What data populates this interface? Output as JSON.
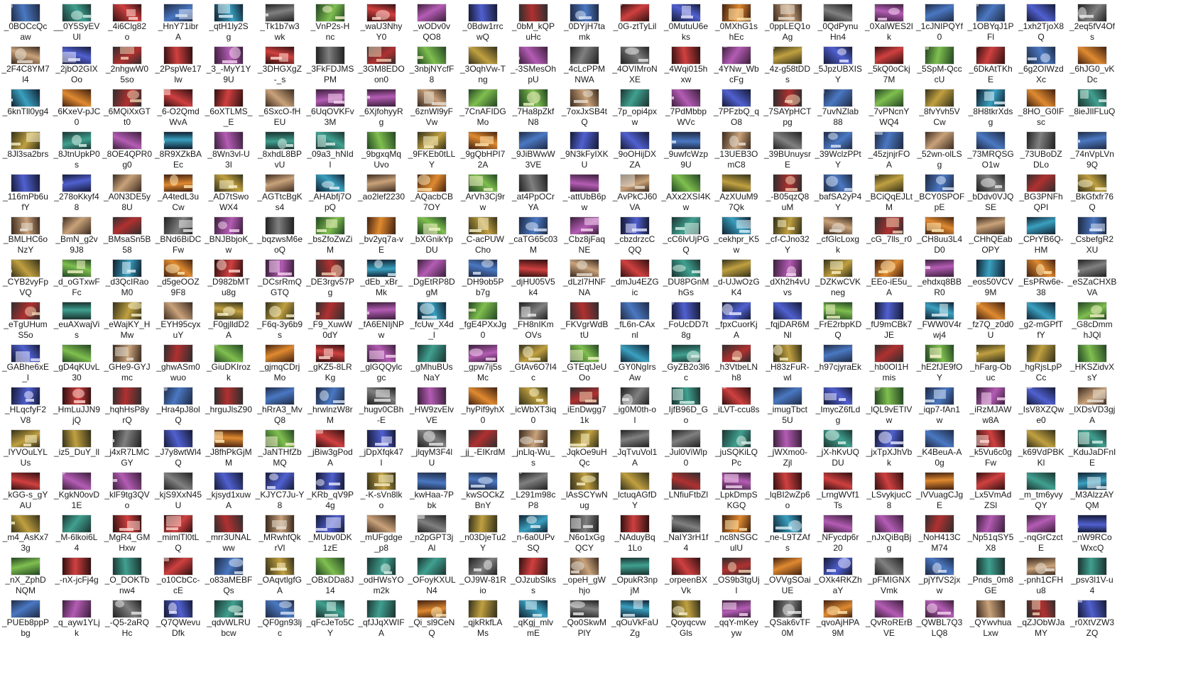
{
  "files": [
    [
      "_0BOCcQc|aw",
      "__0Y5SyEV|Ul",
      "_4i6Clg82|o",
      "_HnY71ibr|A",
      "_qtH1ly2S|g",
      "_Tk1b7w3|wk",
      "_VnP2s-H|nc",
      "_waU3Nhy|Y0",
      "_wODv0v|QO8",
      "_0Bdw1rrc|wQ",
      "_0bM_kQP|uHc",
      "_0DYjH7ta|mk",
      "_0G-ztTyLil|",
      "_0MutuU6e|ks",
      "_0MXhG1s|hEc",
      "_0ppLEQ1o|Ag",
      "_0QdPynu|Hn4",
      "_0XalWES2I|k",
      "_1cJNIPQYf|0",
      "_1OBYqJ1P|Fl",
      "_1xh2TjoX8|Q",
      "_2eq5fV4Of|s"
    ],
    [
      "_2F4C8YM7|l4",
      "_2jbO2GIX|Oo",
      "_2nhgwW0|5so",
      "_2PspWe17|lw",
      "_3_-MyY1Y|9U",
      "_3DHGXgZ|-_s",
      "_3FkFDJMS|PM",
      "_3GM8EDO|on0",
      "_3nbjNYcfF|8",
      "_3OqhVw-T|ng",
      "_-3SMesOh|pU",
      "_4cLcPPM|NWA",
      "_4OVIMroN|XE",
      "_4Wqi015h|xw",
      "_4YNw_Wb|cFg",
      "_4z-g58tDD|s",
      "_5JpzUBXIS|Y",
      "_5kQ0oCkj|7M",
      "_5SpM-Qcc|cU",
      "_6DkAtTKh|E",
      "_6g2OIWzd|Xc",
      "_6hJG0_vK|Dc"
    ],
    [
      "_6knTll0yg4|",
      "_6KxeV-pJC|0",
      "_6MQiXxGT|t0",
      "_6-O2Qmd|WvA",
      "_6oXTLMS_|_E",
      "_6SxcO-fH|EU",
      "_6UqOVKFv|3M",
      "_6XjfohyyR|g",
      "_6znWl9yF|Vw",
      "_7CnAFIDG|Mo",
      "_7Ha8pZkf|N8",
      "_7oxJxSB4t|Q",
      "_7p_opi4px|w",
      "_7PdMbbp|WVc",
      "_7PFzbQ_q|O8",
      "_7SAYpHCT|pg",
      "_7uvNZlab|88",
      "_7vPNcnY|WQ4",
      "_8fvYvh5V|Cw",
      "_8H8tkrXds|g",
      "_8HO_G0IF|sc",
      "_8ieJIlFLuQ|"
    ],
    [
      "_8Jl3sa2brs|",
      "_8JtnUpkP0|s",
      "_8OE4QPR0|g0",
      "_8R9XZkBA|Ec",
      "_8Wn3vl-U|3I",
      "_8xhdL8BP|vU",
      "_09a3_hNId|l",
      "_9bgxqMq|Uvo",
      "_9FKEb0tLL|Y",
      "_9gQbHPI7|2A",
      "_9JiBWwW|3VE",
      "_9N3kFyIXK|U",
      "_9oOHijDX|ZA",
      "_9uwfcWzp|9U",
      "_13UEB3O|mC8",
      "_39BUnuysr|E",
      "_39WclzPPt|Y",
      "_45zjnjrFO|A",
      "_52wn-olLS|g",
      "_73MRQSG|O1w",
      "_73UBoDZ|DLo",
      "_74nVpLVn|9Q"
    ],
    [
      "_116mPb6u|fY",
      "_278oKkyf4|8",
      "_A0N3DE5y|8U",
      "_A4tedL3u|Cw",
      "_AD7tSwo|WX4",
      "_AGTtcBgK|s4",
      "_AHAbfj7O|pQ",
      "_ao2lef2230|",
      "_AQacbCB|7OY",
      "_ArVh3Cj9r|w",
      "_at4PpOCr|YA",
      "_-attUbB6p|w",
      "_AvPkCJ60|VA",
      "_AXx2XSI4K|w",
      "_AzXUuM9|7Qk",
      "_-B05qzQ8|uM",
      "_bafSA2yP4|Y",
      "_BCiQqEJLt|M",
      "_BCY0SPOF|pE",
      "_bDdv0VJQ|SE",
      "_BG3PNFh|QPI",
      "_BkGfxfr76|Q"
    ],
    [
      "_BMLHC6o|NzY",
      "_BmN_g2v|9J8",
      "_BMsaSn5B|58",
      "_BNd6BiDC|Fw",
      "_BNJBbjoK_|w",
      "_bqzwsM6e|oQ",
      "_bsZfoZwZi|M",
      "_bv2yq7a-v|E",
      "_bXGnikYp|DU",
      "_C-acPUW|Cho",
      "_caTG65c03|M",
      "_Cbz8jFaq|NE",
      "_cbzdrzcC|QQ",
      "_cC6lvUjPG|Q",
      "_cekhpr_K5|w",
      "_cf-CJno32|Y",
      "_cfGlcLoxg|k",
      "_cG_7lls_r0|",
      "_CH8uu3L4|D0",
      "_CHhQEab|OPY",
      "_CPrYB6Q-|HM",
      "_CsbefgR2|XU"
    ],
    [
      "_CYB2vyFp|VQ",
      "_d_oGTxwF|Fc",
      "_d3QcIRao|M0",
      "_d5geOOZ|9F8",
      "_D982bMT|u8g",
      "_DCsrRmQ|GTQ",
      "_DE3rgv57P|g",
      "_dEb_xBr_|Mk",
      "_DgEtRP8D|gM",
      "_DH9ob5P|b7g",
      "_djHU05V5|k4",
      "_dLzl7HNF|NA",
      "_dmJu4EZG|ic",
      "_DU8PGnM|hGs",
      "_d-UJwOzG|K4",
      "_dXh2h4vU|vs",
      "_DZKwCVK|neg",
      "_EEo-iE5u_|A",
      "_ehdxq8BB|R0",
      "_eos50VCV|9M",
      "_EsPRw6e-|38",
      "_eSZaCHXB|VA"
    ],
    [
      "_eTgUHum|S5o",
      "_euAXwajVi|s",
      "_eWajKY_H|Mw",
      "_EYH95cyx|uY",
      "_F0gjlldD2|A",
      "_F6q-3y6b9|s",
      "_F9_XuwW|0dY",
      "_fA6ENIjNP|w",
      "_fcUw_X4d|_l",
      "_fgE4PXxJg|0",
      "_FH8nIKm|OVs",
      "_FKVgrWdB|tU",
      "_fL6n-CAx|nl",
      "_FoUcDD7t|8g",
      "_fpxCuorKj|A",
      "_fqjDAR6M|Nl",
      "_FrE2rbpKD|Q",
      "_fU9mCBk7|JE",
      "_FWW0V4r|wj4",
      "_fz7Q_z0d0|U",
      "_g2-mGPfT|fY",
      "_G8cDmm|hJQl"
    ],
    [
      "_GABhe6xE|_l",
      "_gD4qKUvL|30",
      "_GHe9-GYJ|mc",
      "_ghwASm0|wuo",
      "_GiuDKIroz|k",
      "_gjmqCDrj|Mo",
      "_gKZ5-8LR|Kg",
      "_glGQQylc|gc",
      "_gMhuBUs|NaY",
      "_gpw7ij5s|Mc",
      "_GtAv6O7I4|c",
      "_GTEqtJeU|Oo",
      "_GY0NgIrs|Aw",
      "_GyZB2o3l6|c",
      "_h3VtbeLN|h8",
      "_H83zFuR-|wl",
      "_h97cjyraEk|",
      "_hb0OI1H|mis",
      "_hE2fJE9fO|Y",
      "_hFarg-Ob|uc",
      "_hgRjsLpP|Cc",
      "_HKSZidvX|sY"
    ],
    [
      "_HLqcfyF2|V8",
      "_HmLuJJN9|jQ",
      "_hqhHsP8y|rQ",
      "_Hra4pJ8ol|Q",
      "_hrguJlsZ90|",
      "_hRrA3_Mv|Q8",
      "_hrwlnzW8r|M",
      "_hugv0CBh|-E",
      "_HW9zvElv|VE",
      "_hyPif9yhX|0",
      "_icWbXT3iq|0",
      "_iEnDwgg7|1k",
      "_ig0M0th-o|l",
      "_IjfB96D_G|o",
      "_iLVT-ccu8s|",
      "_imugTbct|5U",
      "_ImycZ6fLd|g",
      "_lQL9vETIV|w",
      "_iqp7-fAn1|w",
      "_iRzMJAW|w8A",
      "_IsV8XZQw|e0",
      "_lXDsVD3gj|A"
    ],
    [
      "_lYVOuLYL|Us",
      "_iz5_DuY_ll|",
      "_j4xR7LMC|GY",
      "_J7y8wtWl4|Q",
      "_J8fhPkGjM|M",
      "_JaNTHfZb|MQ",
      "_jBiw3gPod|A",
      "_jDpXfqk47|l",
      "_jlqyM3F4l|U",
      "_jj_-EIKrdM|",
      "_jnLlq-Wu_|s",
      "_JqkOe9uH|Qc",
      "_JqTvuVol1|A",
      "_Jul0ViWlp|0",
      "_juSQKiLQ|Pc",
      "_jWXmo0-|Zjl",
      "_jX-hKvUQ|DU",
      "_jxTpXJhVb|k",
      "_K4BeuA-A|0g",
      "_k5Vu6c0g|Fw",
      "_k69VdPBK|Kl",
      "_KduJaDFnI|E"
    ],
    [
      "_kGG-s_gY|AU",
      "_KgkN0ovD|1E",
      "_klF9tg3QV|o",
      "_kjS9XxN45|U",
      "_kjsyd1xuw|A",
      "_KJYC7Ju-Y|8",
      "_KRb_qV9P|4g",
      "_-K-sVn8lk|o",
      "_kwHaa-7P|bk",
      "_kwSOCkZ|BnY",
      "_L291m98c|P8",
      "_lAsSCYwN|ug",
      "_lctuqAGfD|Y",
      "_LNfiuFtbZl|",
      "_LpkDmpS|KGQ",
      "_lqBI2wZp6|o",
      "_LrngWVf1|Ts",
      "_LSvykjucC|8",
      "_lVVuagCJg|E",
      "_Lx5VmAd|ZSl",
      "_m_tm6yvy|QY",
      "_M3AlzzAY|QM"
    ],
    [
      "_m4_AsKx7|3g",
      "_M-6lkoi6L|4",
      "_MgR4_GM|Hxw",
      "_mimlTl0tL|Q",
      "_mrr3UNAL|ww",
      "_MRwhfQk|rVl",
      "_MUbv0DK|1zE",
      "_mUFgdge|_p8",
      "_n2pGPT3j|Al",
      "_n03DjeTu2|Y",
      "_n-6a0UPv|SQ",
      "_N6o1xGg|QCY",
      "_NAduyBq|1Lo",
      "_NaIY3rH1f|4",
      "_nc8NSGC|ulU",
      "_ne-L9TZAf|s",
      "_NFycdp6r|20",
      "_nJxQiBqBj|g",
      "_NoH413C|M74",
      "_Np51qSY5|X8",
      "_-nqGrCzct|E",
      "_nW9RCo|WxcQ"
    ],
    [
      "_nX_ZphD|NQM",
      "_-nX-jcFj4g|",
      "_O_DOKTb|nw4",
      "_o10CbCc-|cE",
      "_o83aMEBF|Qs",
      "_OAqvtlgfG|A",
      "_OBxDDa8J|14",
      "_odHWsYO|m2k",
      "_OFoyKXUL|N4",
      "_OJ9W-81R|io",
      "_OJzubSlks|s",
      "_opeH_gW|hjo",
      "_OpukR3np|jM",
      "_orpeenBX|Vk",
      "_OS9b3tgUj|l",
      "_OVVgSOai|UE",
      "_OXk4RKZh|aY",
      "_pFMIGNX|Vmk",
      "_pjYfVS2jx|w",
      "_Pnds_0m8|GE",
      "_-pnh1CFH|u8",
      "_psv3l1V-u|4"
    ],
    [
      "_PUEb8ppP|bg",
      "_q_ayw1YLj|k",
      "_-Q5-2aRQ|Hc",
      "_Q7QWevu|Dfk",
      "_qdvWLRU|bcw",
      "_QF0gn93lj|c",
      "_qFcJeTo5C|Y",
      "_qfJJqXWIF|A",
      "_Qi_sl9CeN|Q",
      "_qjkRkfLA|Ms",
      "_qKgj_mlv|mE",
      "_Qo0SkwM|PlY",
      "_qOuVkFaU|Zg",
      "_Qoyqcvw|Gls",
      "_qqY-mKey|yw",
      "_QSak6vTF|0M",
      "_qvoAjHPA|9M",
      "_QvRoRErB|VE",
      "_QWBL7Q3|LQ8",
      "_QYwvhua|Lxw",
      "_qZJObWJa|MY",
      "_r0XtVZW3|ZQ"
    ]
  ]
}
